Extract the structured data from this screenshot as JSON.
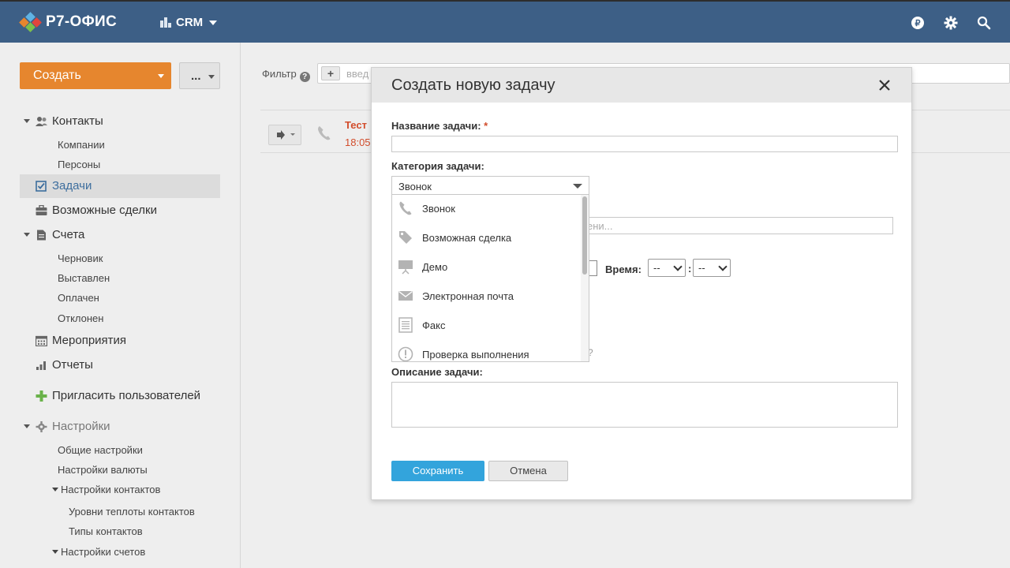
{
  "header": {
    "logo_text": "Р7-ОФИС",
    "module_label": "CRM",
    "icons": [
      "ruble-icon",
      "gear-icon",
      "search-icon"
    ]
  },
  "sidebar": {
    "create_label": "Создать",
    "more_label": "...",
    "items": [
      {
        "label": "Контакты",
        "icon": "contacts-icon",
        "subitems": [
          "Компании",
          "Персоны"
        ]
      },
      {
        "label": "Задачи",
        "icon": "tasks-icon",
        "active": true
      },
      {
        "label": "Возможные сделки",
        "icon": "deals-icon"
      },
      {
        "label": "Счета",
        "icon": "invoices-icon",
        "subitems": [
          "Черновик",
          "Выставлен",
          "Оплачен",
          "Отклонен"
        ]
      },
      {
        "label": "Мероприятия",
        "icon": "calendar-icon"
      },
      {
        "label": "Отчеты",
        "icon": "reports-icon"
      },
      {
        "label": "Пригласить пользователей",
        "icon": "plus-icon"
      },
      {
        "label": "Настройки",
        "icon": "gear-icon",
        "subitems": [
          "Общие настройки",
          "Настройки валюты",
          "Настройки контактов",
          "Уровни теплоты контактов",
          "Типы контактов",
          "Настройки счетов"
        ]
      }
    ]
  },
  "content": {
    "filter_label": "Фильтр",
    "filter_placeholder": "введ",
    "task_title": "Тест",
    "task_time": "18:05"
  },
  "modal": {
    "title": "Создать новую задачу",
    "name_label": "Название задачи:",
    "required_mark": "*",
    "category_label": "Категория задачи:",
    "category_value": "Звонок",
    "category_options": [
      {
        "label": "Звонок",
        "icon": "phone-icon"
      },
      {
        "label": "Возможная сделка",
        "icon": "tag-icon"
      },
      {
        "label": "Демо",
        "icon": "presentation-icon"
      },
      {
        "label": "Электронная почта",
        "icon": "mail-icon"
      },
      {
        "label": "Факс",
        "icon": "fax-icon"
      },
      {
        "label": "Проверка выполнения",
        "icon": "exclamation-icon"
      }
    ],
    "hidden_input_placeholder": "ени...",
    "time_label": "Время:",
    "hour_value": "--",
    "minute_value": "--",
    "time_separator": ":",
    "question_fragment": "?",
    "description_label": "Описание задачи:",
    "save_label": "Сохранить",
    "cancel_label": "Отмена"
  },
  "colors": {
    "header_bg": "#3d5f86",
    "accent_orange": "#e6862e",
    "save_blue": "#33a4dc",
    "link_blue": "#3d6e9e",
    "task_red": "#d24d2c"
  }
}
